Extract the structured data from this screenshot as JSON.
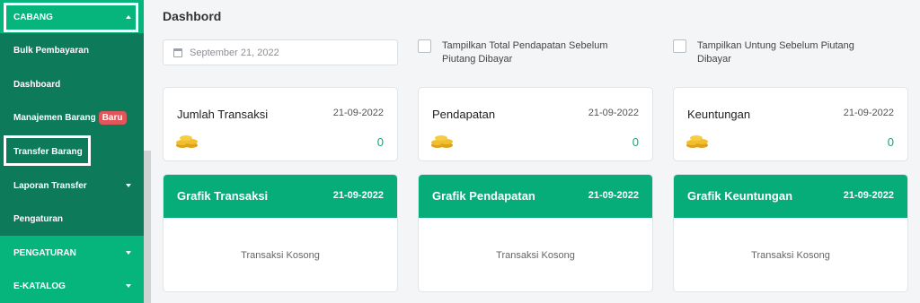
{
  "sidebar": {
    "items": [
      {
        "label": "CABANG"
      },
      {
        "label": "Bulk Pembayaran"
      },
      {
        "label": "Dashboard"
      },
      {
        "label": "Manajemen Barang",
        "badge": "Baru"
      },
      {
        "label": "Transfer Barang"
      },
      {
        "label": "Laporan Transfer"
      },
      {
        "label": "Pengaturan"
      },
      {
        "label": "PENGATURAN"
      },
      {
        "label": "E-KATALOG"
      }
    ]
  },
  "main": {
    "title": "Dashbord",
    "date_input": "September 21, 2022",
    "checkbox1": {
      "line1": "Tampilkan Total Pendapatan Sebelum",
      "line2": "Piutang Dibayar"
    },
    "checkbox2": {
      "line1": "Tampilkan Untung Sebelum Piutang",
      "line2": "Dibayar"
    },
    "stats": [
      {
        "title": "Jumlah Transaksi",
        "date": "21-09-2022",
        "value": "0"
      },
      {
        "title": "Pendapatan",
        "date": "21-09-2022",
        "value": "0"
      },
      {
        "title": "Keuntungan",
        "date": "21-09-2022",
        "value": "0"
      }
    ],
    "graphs": [
      {
        "title": "Grafik Transaksi",
        "date": "21-09-2022",
        "empty": "Transaksi Kosong"
      },
      {
        "title": "Grafik Pendapatan",
        "date": "21-09-2022",
        "empty": "Transaksi Kosong"
      },
      {
        "title": "Grafik Keuntungan",
        "date": "21-09-2022",
        "empty": "Transaksi Kosong"
      }
    ]
  },
  "colors": {
    "sidebar_dark": "#0d7a5a",
    "sidebar_light": "#05b57c",
    "accent": "#06ad79",
    "badge": "#e0565b"
  }
}
